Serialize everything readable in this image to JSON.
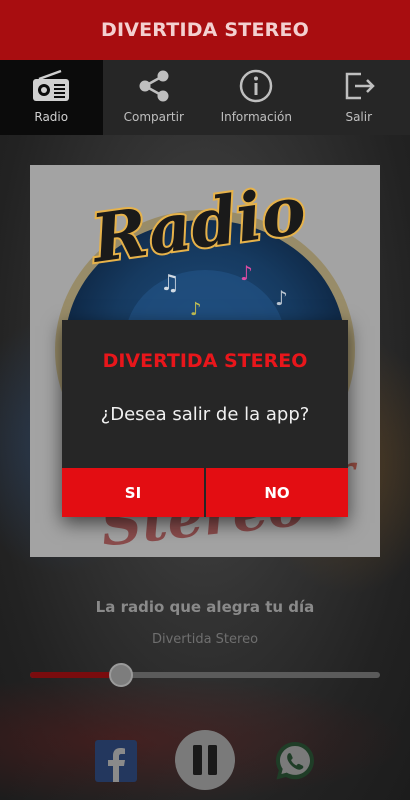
{
  "app_title": "DIVERTIDA STEREO",
  "tabs": [
    {
      "label": "Radio",
      "icon": "radio-icon",
      "active": true
    },
    {
      "label": "Compartir",
      "icon": "share-icon",
      "active": false
    },
    {
      "label": "Información",
      "icon": "info-icon",
      "active": false
    },
    {
      "label": "Salir",
      "icon": "exit-icon",
      "active": false
    }
  ],
  "cover": {
    "logo_text": "Radio"
  },
  "player": {
    "tagline": "La radio que alegra tu día",
    "station": "Divertida Stereo",
    "progress": 0.26
  },
  "social": {
    "left_icon": "facebook-icon",
    "right_icon": "whatsapp-icon"
  },
  "dialog": {
    "title": "DIVERTIDA STEREO",
    "message": "¿Desea salir de la app?",
    "yes_label": "SI",
    "no_label": "NO"
  },
  "colors": {
    "app_bar": "#a80d10",
    "accent_red": "#e30d12",
    "dialog_bg": "#262626"
  }
}
